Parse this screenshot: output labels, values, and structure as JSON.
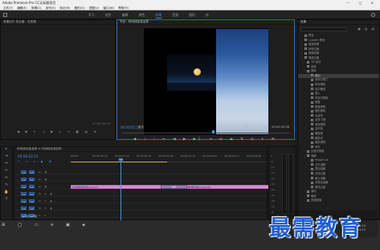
{
  "window": {
    "title": "Adobe Premiere Pro CC无标题项目",
    "controls": [
      "—",
      "□",
      "✕"
    ]
  },
  "menu": [
    "文件(F)",
    "编辑(E)",
    "剪辑(C)",
    "序列(S)",
    "标记(M)",
    "图形(G)",
    "视图(V)",
    "窗口(W)",
    "帮助(H)"
  ],
  "workspaces": {
    "tabs": [
      "学习",
      "组件",
      "编辑",
      "颜色",
      "效果",
      "音频",
      "图形",
      "库"
    ],
    "active_index": 4
  },
  "source_panel": {
    "title": "效果控件 混合器：无剪辑",
    "timecode": "00:00:00:00",
    "controls": "◀ ▶ ⇤ ◁ ▶ ▷ ⇥ ▣ ▤ ⊕"
  },
  "program_panel": {
    "title": "节目：时间线标准名称",
    "timecode_current": "00:00:02:21",
    "fit": "适合",
    "zoom": "1/2",
    "timecode_total": "00:00:03:08",
    "playhead_fraction": 0.54,
    "controls": "◆ ⏐ ⏐ ⇤ ◀ ▶ ▶▏ ⇥ ⇄ ⏏ ⇅ ◎ + ⊞"
  },
  "effects_panel": {
    "title": "效果",
    "tools": "▣ ▤ ▥",
    "items": [
      {
        "label": "预设",
        "level": 0,
        "arrow": "›"
      },
      {
        "label": "Lumetri 预设",
        "level": 0,
        "arrow": "›"
      },
      {
        "label": "音频效果",
        "level": 0,
        "arrow": "›"
      },
      {
        "label": "音频过渡",
        "level": 0,
        "arrow": "›"
      },
      {
        "label": "视频效果",
        "level": 0,
        "arrow": "›"
      },
      {
        "label": "视频过渡",
        "level": 0,
        "arrow": "⌄"
      },
      {
        "label": "3D 运动",
        "level": 1,
        "arrow": "›"
      },
      {
        "label": "划像",
        "level": 1,
        "arrow": "›"
      },
      {
        "label": "擦除",
        "level": 1,
        "arrow": "⌄"
      },
      {
        "label": "划出",
        "level": 2,
        "arrow": "",
        "selected": true
      },
      {
        "label": "双侧平推门",
        "level": 2,
        "arrow": ""
      },
      {
        "label": "带状擦除",
        "level": 2,
        "arrow": ""
      },
      {
        "label": "径向擦除",
        "level": 2,
        "arrow": ""
      },
      {
        "label": "插入",
        "level": 2,
        "arrow": ""
      },
      {
        "label": "时钟式擦除",
        "level": 2,
        "arrow": ""
      },
      {
        "label": "棋盘",
        "level": 2,
        "arrow": ""
      },
      {
        "label": "棋盘擦除",
        "level": 2,
        "arrow": ""
      },
      {
        "label": "楔形擦除",
        "level": 2,
        "arrow": ""
      },
      {
        "label": "水波块",
        "level": 2,
        "arrow": ""
      },
      {
        "label": "油漆飞溅",
        "level": 2,
        "arrow": ""
      },
      {
        "label": "渐变擦除",
        "level": 2,
        "arrow": ""
      },
      {
        "label": "百叶窗",
        "level": 2,
        "arrow": ""
      },
      {
        "label": "螺旋框",
        "level": 2,
        "arrow": ""
      },
      {
        "label": "随机块",
        "level": 2,
        "arrow": ""
      },
      {
        "label": "随机擦除",
        "level": 2,
        "arrow": ""
      },
      {
        "label": "风车",
        "level": 2,
        "arrow": ""
      },
      {
        "label": "沉浸式视频",
        "level": 1,
        "arrow": "›"
      },
      {
        "label": "溶解",
        "level": 1,
        "arrow": "⌄"
      },
      {
        "label": "MorphCut",
        "level": 2,
        "arrow": ""
      },
      {
        "label": "交叉溶解",
        "level": 2,
        "arrow": ""
      },
      {
        "label": "叠加溶解",
        "level": 2,
        "arrow": ""
      },
      {
        "label": "白场过渡",
        "level": 2,
        "arrow": ""
      },
      {
        "label": "胶片溶解",
        "level": 2,
        "arrow": ""
      },
      {
        "label": "非叠加溶解",
        "level": 2,
        "arrow": ""
      },
      {
        "label": "黑场过渡",
        "level": 2,
        "arrow": ""
      },
      {
        "label": "滑动",
        "level": 1,
        "arrow": "›"
      },
      {
        "label": "缩放",
        "level": 1,
        "arrow": "›"
      },
      {
        "label": "页面剥落",
        "level": 1,
        "arrow": "›"
      }
    ]
  },
  "tools": [
    "▸",
    "⇥",
    "⇔",
    "✂",
    "↔",
    "✎",
    "✋",
    "T"
  ],
  "timeline": {
    "title": "时间线标准名称 ≡ 时间线标准名称",
    "timecode": "00:00:02:21",
    "tools": "⊓ ∩ ◂ ◆ ⚙",
    "ruler": [
      "00:00",
      "00:00:00:15",
      "00:00:01:00",
      "00:00:01:15",
      "00:00:02:00",
      "00:00:02:15",
      "00:00:03:00",
      "00:00:03:15",
      "00:00:04:00"
    ],
    "tracks": [
      {
        "name": "V3",
        "label": "V3",
        "icons": "⊟ ◉"
      },
      {
        "name": "V2",
        "label": "V2",
        "icons": "⊟ ◉"
      },
      {
        "name": "V1",
        "label": "V1",
        "icons": "⊟ ◉"
      },
      {
        "name": "A1",
        "label": "A1",
        "icons": "M S ◉"
      },
      {
        "name": "A2",
        "label": "A2",
        "icons": "M S ◉"
      },
      {
        "name": "A3",
        "label": "A3",
        "icons": "M S ◉"
      },
      {
        "name": "主声道",
        "label": "主声道",
        "icons": "0.0"
      }
    ],
    "clips": [
      {
        "name": "时间线标准名称.mp4 [V]",
        "track": "V1",
        "start": 0.0,
        "end": 2.5
      },
      {
        "name": "划出",
        "track": "V1",
        "start": 2.05,
        "end": 2.65,
        "type": "transition"
      },
      {
        "name": "时间线标准名称02.mp4 [V]",
        "track": "V1",
        "start": 2.5,
        "end": 5.0
      }
    ]
  },
  "audio_meter": {
    "scale": [
      "0",
      "-6",
      "-12",
      "-18",
      "-24",
      "-30",
      "-36",
      "-42",
      "-48",
      "-54",
      "dB"
    ],
    "buttons": "S S"
  },
  "taskbar": {
    "start": "⊞ ◯ ▭ e ▣ ◈",
    "tray": "^ ◧ ◫ 中",
    "time": "8:54",
    "date": "2021/10/15"
  },
  "watermark": "最需教育"
}
